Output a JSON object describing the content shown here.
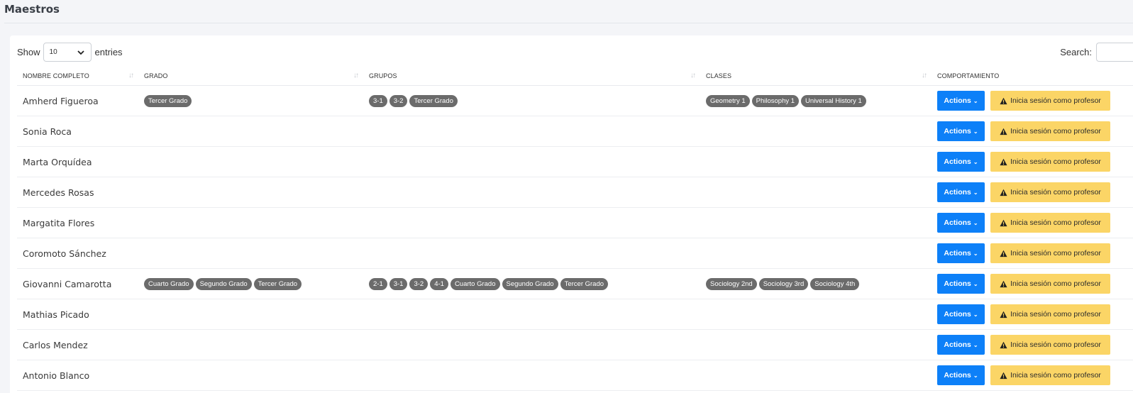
{
  "page": {
    "title": "Maestros"
  },
  "controls": {
    "show_label": "Show",
    "entries_value": "10",
    "entries_label": "entries",
    "search_label": "Search:"
  },
  "columns": [
    "NOMBRE COMPLETO",
    "GRADO",
    "GRUPOS",
    "CLASES",
    "COMPORTAMIENTO"
  ],
  "row_actions": {
    "actions_label": "Actions",
    "login_label": "Inicia sesión como profesor"
  },
  "rows": [
    {
      "name": "Amherd Figueroa",
      "grados": [
        "Tercer Grado"
      ],
      "grupos": [
        "3-1",
        "3-2",
        "Tercer Grado"
      ],
      "clases": [
        "Geometry 1",
        "Philosophy 1",
        "Universal History 1"
      ]
    },
    {
      "name": "Sonia Roca",
      "grados": [],
      "grupos": [],
      "clases": []
    },
    {
      "name": "Marta Orquídea",
      "grados": [],
      "grupos": [],
      "clases": []
    },
    {
      "name": "Mercedes Rosas",
      "grados": [],
      "grupos": [],
      "clases": []
    },
    {
      "name": "Margatita Flores",
      "grados": [],
      "grupos": [],
      "clases": []
    },
    {
      "name": "Coromoto Sánchez",
      "grados": [],
      "grupos": [],
      "clases": []
    },
    {
      "name": "Giovanni Camarotta",
      "grados": [
        "Cuarto Grado",
        "Segundo Grado",
        "Tercer Grado"
      ],
      "grupos": [
        "2-1",
        "3-1",
        "3-2",
        "4-1",
        "Cuarto Grado",
        "Segundo Grado",
        "Tercer Grado"
      ],
      "clases": [
        "Sociology 2nd",
        "Sociology 3rd",
        "Sociology 4th"
      ]
    },
    {
      "name": "Mathias Picado",
      "grados": [],
      "grupos": [],
      "clases": []
    },
    {
      "name": "Carlos Mendez",
      "grados": [],
      "grupos": [],
      "clases": []
    },
    {
      "name": "Antonio Blanco",
      "grados": [],
      "grupos": [],
      "clases": []
    }
  ],
  "colors": {
    "actions_button": "#0d80f8",
    "login_button": "#fbd566",
    "badge": "#6b6b6b"
  }
}
